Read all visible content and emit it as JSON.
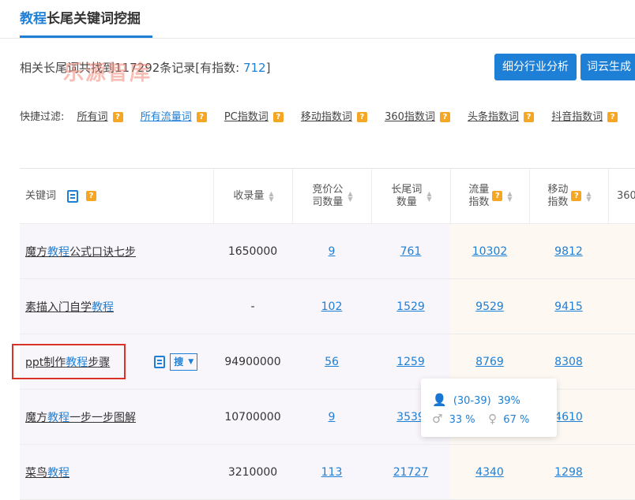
{
  "title": {
    "kw": "教程",
    "rest": "长尾关键词挖掘"
  },
  "summary": {
    "prefix": "相关长尾词共找到",
    "count": "11729",
    "mid": "2条记录[有指数: ",
    "index_count": "712",
    "suffix": "]"
  },
  "watermark": "乐源智库",
  "buttons": {
    "industry": "细分行业分析",
    "cloud": "词云生成"
  },
  "filters": {
    "label": "快捷过滤:",
    "items": [
      "所有词",
      "所有流量词",
      "PC指数词",
      "移动指数词",
      "360指数词",
      "头条指数词",
      "抖音指数词"
    ]
  },
  "table": {
    "headers": {
      "keyword": "关键词",
      "indexed": "收录量",
      "bid_l1": "竞价公",
      "bid_l2": "司数量",
      "long_l1": "长尾词",
      "long_l2": "数量",
      "flow_l1": "流量",
      "flow_l2": "指数",
      "mobile_l1": "移动",
      "mobile_l2": "指数",
      "h360": "360"
    },
    "rows": [
      {
        "kw_pre": "魔方",
        "kw_hl": "教程",
        "kw_post": "公式口诀七步",
        "indexed": "1650000",
        "bid": "9",
        "long": "761",
        "flow": "10302",
        "mobile": "9812"
      },
      {
        "kw_pre": "素描入门自学",
        "kw_hl": "教程",
        "kw_post": "",
        "indexed": "-",
        "bid": "102",
        "long": "1529",
        "flow": "9529",
        "mobile": "9415"
      },
      {
        "kw_pre": "ppt制作",
        "kw_hl": "教程",
        "kw_post": "步骤",
        "indexed": "94900000",
        "bid": "56",
        "long": "1259",
        "flow": "8769",
        "mobile": "8308",
        "search_btn": "搜"
      },
      {
        "kw_pre": "魔方",
        "kw_hl": "教程",
        "kw_post": "一步一步图解",
        "indexed": "10700000",
        "bid": "9",
        "long": "3539",
        "flow": "",
        "mobile": "4610"
      },
      {
        "kw_pre": "菜鸟",
        "kw_hl": "教程",
        "kw_post": "",
        "indexed": "3210000",
        "bid": "113",
        "long": "21727",
        "flow": "4340",
        "mobile": "1298"
      }
    ]
  },
  "tooltip": {
    "age": "(30-39)",
    "age_pct": "39%",
    "male_pct": "33 %",
    "female_pct": "67 %"
  },
  "colors": {
    "accent": "#1e7fd6",
    "warn": "#f5a623",
    "highlight_box": "#d9322b"
  }
}
